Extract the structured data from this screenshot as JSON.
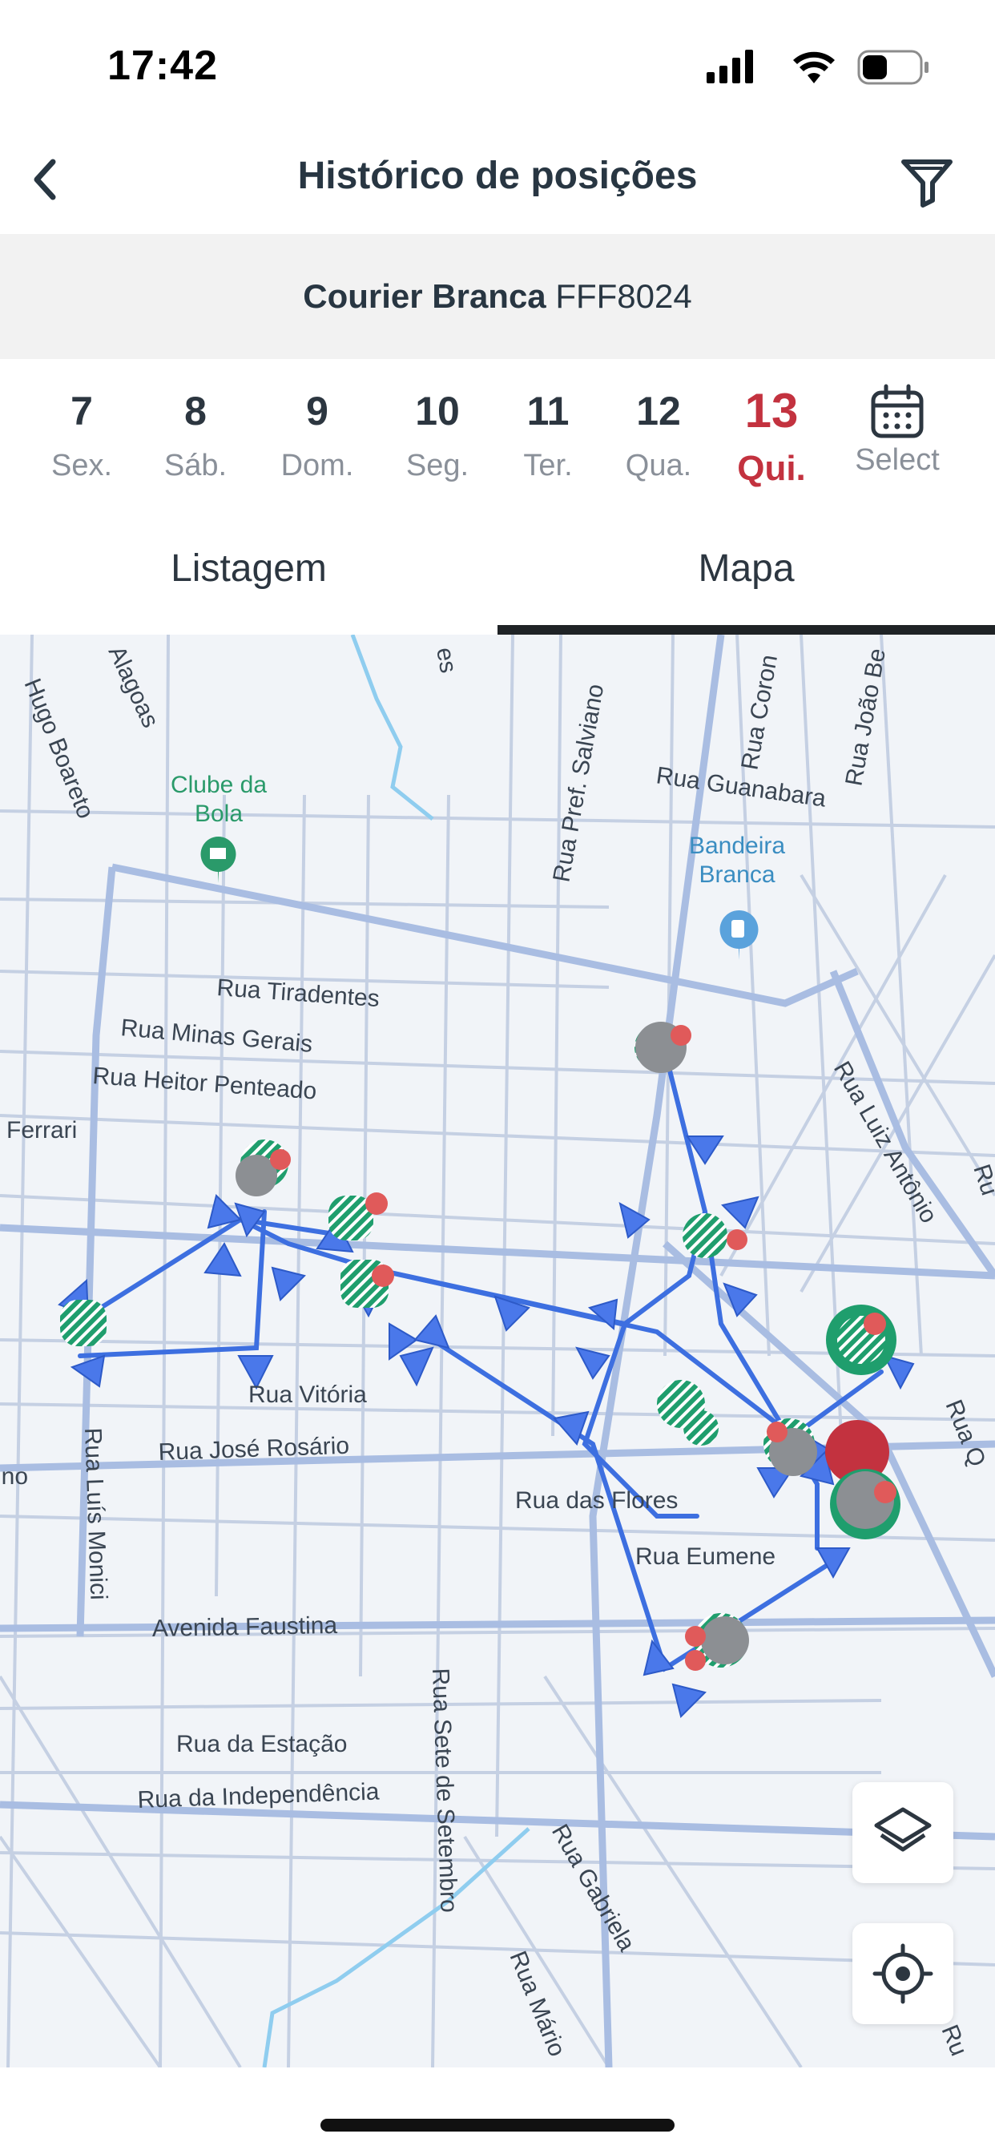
{
  "status_bar": {
    "time": "17:42"
  },
  "header": {
    "title": "Histórico de posições"
  },
  "vehicle": {
    "name": "Courier Branca",
    "plate": "FFF8024"
  },
  "dates": [
    {
      "num": "7",
      "weekday": "Sex."
    },
    {
      "num": "8",
      "weekday": "Sáb."
    },
    {
      "num": "9",
      "weekday": "Dom."
    },
    {
      "num": "10",
      "weekday": "Seg."
    },
    {
      "num": "11",
      "weekday": "Ter."
    },
    {
      "num": "12",
      "weekday": "Qua."
    },
    {
      "num": "13",
      "weekday": "Qui."
    }
  ],
  "select_label": "Select",
  "tabs": {
    "list": "Listagem",
    "map": "Mapa"
  },
  "map": {
    "pois": {
      "clube": "Clube da\nBola",
      "bandeira": "Bandeira\nBranca"
    },
    "streets": {
      "hugo": "Hugo Boareto",
      "alagoas": "Alagoas",
      "es": "es",
      "salviano": "Rua Pref. Salviano",
      "coron": "Rua Coron",
      "joao": "Rua João Be",
      "guanabara": "Rua Guanabara",
      "tiradentes": "Rua Tiradentes",
      "minas": "Rua Minas Gerais",
      "heitor": "Rua Heitor Penteado",
      "ferrari": "Ferrari",
      "luiz": "Rua Luiz Antônio",
      "ru": "Ru",
      "vitoria": "Rua Vitória",
      "jose": "Rua José Rosário",
      "ino": "ino",
      "flores": "Rua das Flores",
      "eumene": "Rua Eumene",
      "faustina": "Avenida Faustina",
      "monici": "Rua Luís Monici",
      "estacao": "Rua da Estação",
      "independencia": "Rua da Independência",
      "setembro": "Rua Sete de Setembro",
      "gabriela": "Rua Gabriela",
      "mario": "Rua Mário",
      "rq": "Rua Q",
      "ru2": "Ru"
    }
  },
  "colors": {
    "accent_red": "#c3323f",
    "route_blue": "#3d6fe0",
    "marker_green": "#1f9e6d",
    "marker_gray": "#8c8f93"
  },
  "icons": {
    "back": "chevron-left-icon",
    "filter": "filter-icon",
    "calendar": "calendar-icon",
    "layers": "layers-icon",
    "locate": "locate-icon"
  }
}
